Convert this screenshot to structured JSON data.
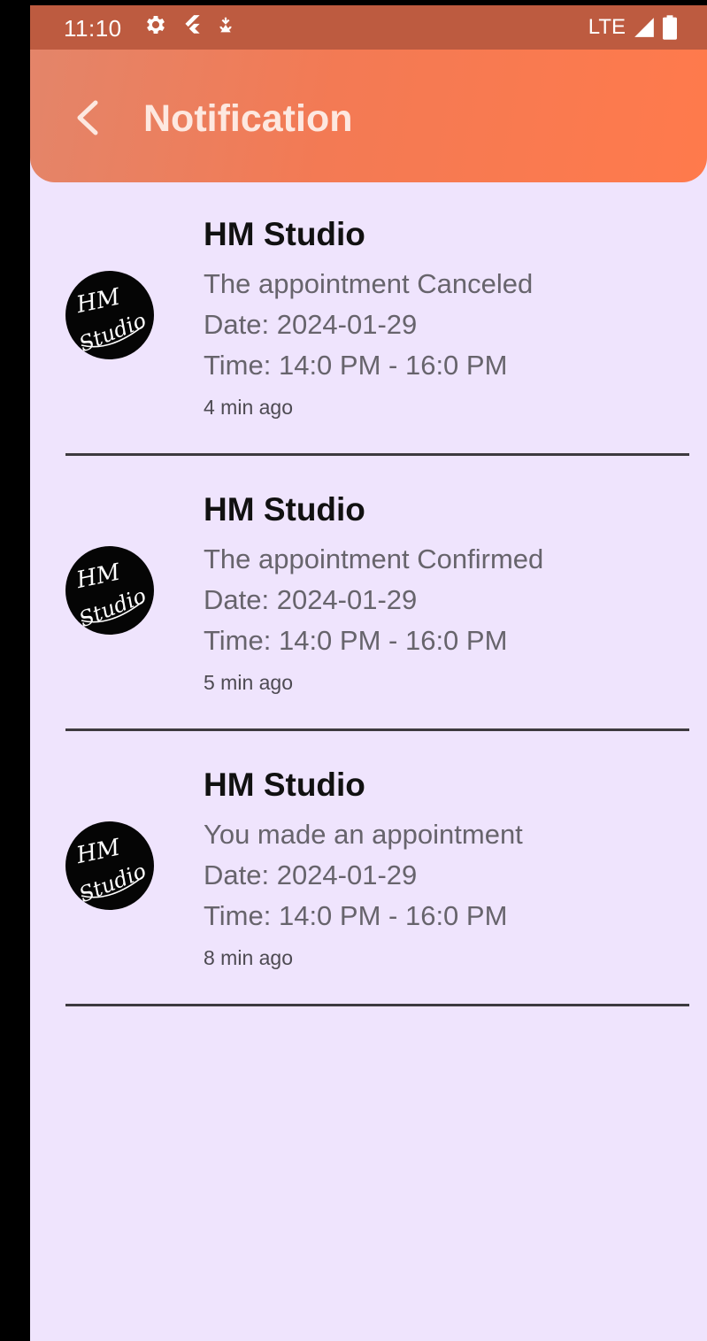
{
  "status_bar": {
    "time": "11:10",
    "network": "LTE",
    "icons": [
      "settings-icon",
      "flutter-icon",
      "location-pin-icon",
      "signal-icon",
      "battery-icon"
    ]
  },
  "app_bar": {
    "title": "Notification",
    "back_icon": "chevron-left-icon"
  },
  "colors": {
    "header_start": "#e3856a",
    "header_end": "#ff7a4c",
    "status_bar": "#bd5b40",
    "background": "#efe4fd",
    "divider": "#3d3a3f"
  },
  "notifications": [
    {
      "sender": "HM Studio",
      "avatar_text": "HM Studio",
      "message": "The appointment Canceled",
      "date": "Date: 2024-01-29",
      "time": "Time: 14:0 PM - 16:0 PM",
      "ago": "4 min ago"
    },
    {
      "sender": "HM Studio",
      "avatar_text": "HM Studio",
      "message": "The appointment Confirmed",
      "date": "Date: 2024-01-29",
      "time": "Time: 14:0 PM - 16:0 PM",
      "ago": "5 min ago"
    },
    {
      "sender": "HM Studio",
      "avatar_text": "HM Studio",
      "message": "You made an appointment",
      "date": "Date: 2024-01-29",
      "time": "Time: 14:0 PM - 16:0 PM",
      "ago": "8 min ago"
    }
  ]
}
